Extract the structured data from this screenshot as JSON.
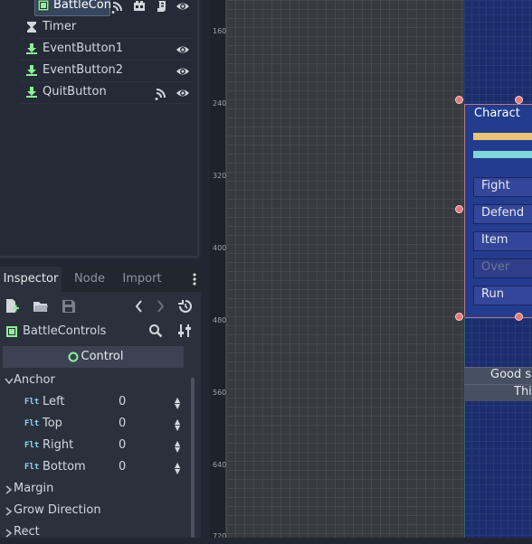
{
  "scene_tree": {
    "nodes": [
      {
        "label": "BattleCon",
        "icon": "control-node-icon"
      },
      {
        "label": "Timer",
        "icon": "timer-icon"
      },
      {
        "label": "EventButton1",
        "icon": "button-node-icon"
      },
      {
        "label": "EventButton2",
        "icon": "button-node-icon"
      },
      {
        "label": "QuitButton",
        "icon": "button-node-icon"
      }
    ]
  },
  "inspector": {
    "tabs": [
      "Inspector",
      "Node",
      "Import"
    ],
    "object_name": "BattleControls",
    "section": "Control",
    "anchor_group": "Anchor",
    "props": [
      {
        "type": "Flt",
        "label": "Left",
        "value": "0"
      },
      {
        "type": "Flt",
        "label": "Top",
        "value": "0"
      },
      {
        "type": "Flt",
        "label": "Right",
        "value": "0"
      },
      {
        "type": "Flt",
        "label": "Bottom",
        "value": "0"
      }
    ],
    "groups": [
      "Margin",
      "Grow Direction",
      "Rect"
    ]
  },
  "ruler": {
    "labels": [
      "160",
      "240",
      "320",
      "400",
      "480",
      "560",
      "640",
      "720"
    ]
  },
  "game": {
    "panel_title": "Charact",
    "buttons": [
      "Fight",
      "Defend",
      "Item",
      "Over",
      "Run"
    ],
    "messages": [
      "Good s",
      "Thi"
    ]
  },
  "colors": {
    "accent": "#36475d",
    "game_bg": "#1c2d6b",
    "hp_bar": "#e8c47a",
    "mp_bar": "#7fd7dc",
    "handle": "#e27a7a"
  }
}
